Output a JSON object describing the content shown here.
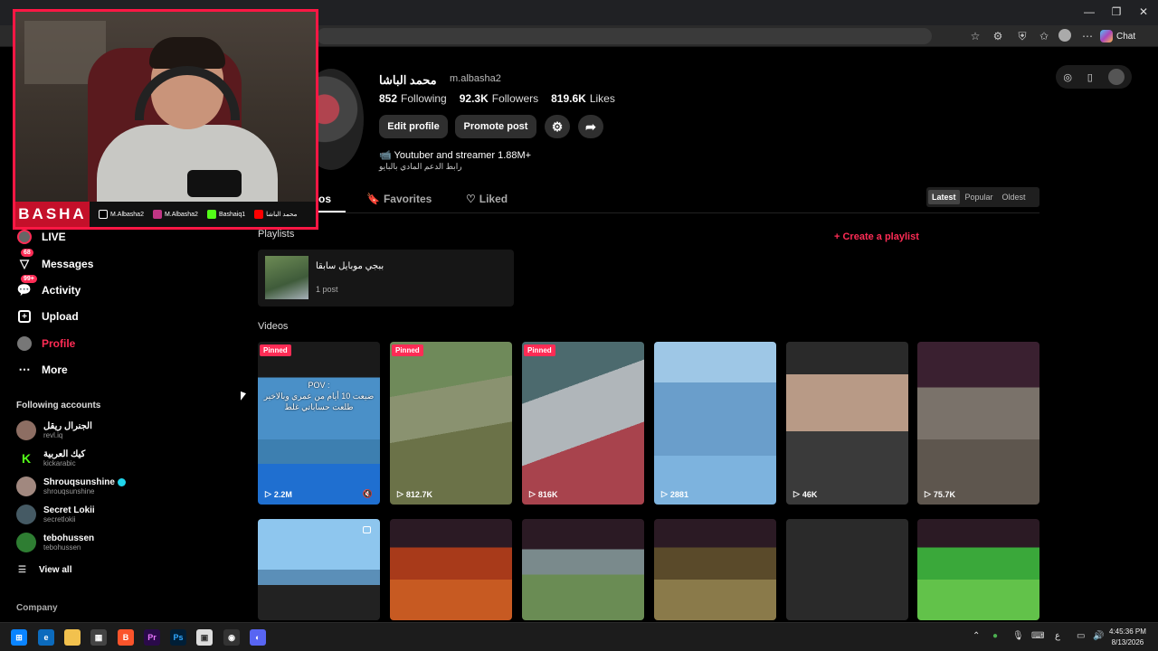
{
  "browser": {
    "chat_label": "Chat",
    "window_controls": [
      "—",
      "❐",
      "✕"
    ]
  },
  "webcam": {
    "brand": "BASHA",
    "socials": [
      {
        "label": "M.Albasha2",
        "color": "#000000",
        "icon": "tiktok-icon"
      },
      {
        "label": "M.Albasha2",
        "color": "#c13584",
        "icon": "instagram-icon"
      },
      {
        "label": "Bashaiq1",
        "color": "#53fc18",
        "icon": "kick-icon"
      },
      {
        "label": "محمد الباشا",
        "color": "#ff0000",
        "icon": "youtube-icon"
      }
    ]
  },
  "sidebar": {
    "items": [
      {
        "label": "LIVE",
        "icon": "live-icon"
      },
      {
        "label": "Messages",
        "icon": "messages-icon",
        "badge": "68"
      },
      {
        "label": "Activity",
        "icon": "activity-icon",
        "badge": "99+"
      },
      {
        "label": "Upload",
        "icon": "upload-icon"
      },
      {
        "label": "Profile",
        "icon": "profile-icon"
      },
      {
        "label": "More",
        "icon": "more-icon"
      }
    ],
    "following_title": "Following accounts",
    "accounts": [
      {
        "name": "الجنرال ريقل",
        "handle": "revl.iq",
        "color": "#8d6e63"
      },
      {
        "name": "كيك العربية",
        "handle": "kickarabic",
        "color": "#53fc18"
      },
      {
        "name": "Shrouqsunshine",
        "handle": "shrouqsunshine",
        "color": "#a1887f",
        "verified": true
      },
      {
        "name": "Secret Lokii",
        "handle": "secretlokii",
        "color": "#455a64"
      },
      {
        "name": "tebohussen",
        "handle": "tebohussen",
        "color": "#2e7d32"
      }
    ],
    "view_all": "View all",
    "company": "Company"
  },
  "profile": {
    "name": "محمد الباشا",
    "handle": "m.albasha2",
    "following_count": "852",
    "following_label": "Following",
    "followers_count": "92.3K",
    "followers_label": "Followers",
    "likes_count": "819.6K",
    "likes_label": "Likes",
    "edit_profile": "Edit profile",
    "promote_post": "Promote post",
    "bio_line1": "📹 Youtuber and streamer 1.88M+",
    "bio_line2": "رابط الدعم المادي بالبايو"
  },
  "tabs": {
    "videos_partial": "os",
    "favorites": "Favorites",
    "liked": "Liked"
  },
  "sort": {
    "options": [
      "Latest",
      "Popular",
      "Oldest"
    ],
    "selected": "Latest"
  },
  "playlists": {
    "title": "Playlists",
    "create": "+ Create a playlist",
    "items": [
      {
        "title": "ببجي موبايل سابقا",
        "count": "1 post"
      }
    ]
  },
  "videos": {
    "title": "Videos",
    "pinned_label": "Pinned",
    "row1": [
      {
        "views": "2.2M",
        "pinned": true,
        "overlay": "POV :\nضيعت 10 أيام من عمري وبالاخير\nطلعت حساباتي غلط",
        "bg": "linear-gradient(180deg,#1a1a1a 0 22%,#4a90c8 22% 60%,#3d7fb0 60% 75%,#1f6fd0 75%)"
      },
      {
        "views": "812.7K",
        "pinned": true,
        "overlay": "",
        "bg": "linear-gradient(170deg,#6f8a5a 0 30%,#8a9270 30% 55%,#6b7248 55% 100%)"
      },
      {
        "views": "816K",
        "pinned": true,
        "overlay": "",
        "bg": "linear-gradient(160deg,#4c6a6e 0 30%,#b0b6ba 30% 60%,#a8434d 60% 100%)"
      },
      {
        "views": "2881",
        "pinned": false,
        "overlay": "",
        "bg": "linear-gradient(180deg,#9ec7e6 0 25%,#6a9ecb 25% 70%,#7db3de 70%)"
      },
      {
        "views": "46K",
        "pinned": false,
        "overlay": "",
        "bg": "linear-gradient(180deg,#2a2a2a 0 20%,#b89a86 20% 55%,#3a3a3a 55%)"
      },
      {
        "views": "75.7K",
        "pinned": false,
        "overlay": "",
        "bg": "linear-gradient(180deg,#3a2030 0 28%,#7a726a 28% 60%,#5e564e 60%)"
      }
    ],
    "row2": [
      {
        "bg": "linear-gradient(180deg,#8ec6ee 0 50%,#5b8fb8 50% 65%,#222 65%)",
        "corner": true
      },
      {
        "bg": "linear-gradient(180deg,#2b1a24 0 28%,#a83a1a 28% 60%,#c75a22 60%)"
      },
      {
        "bg": "linear-gradient(180deg,#2b1a24 0 30%,#7a8a8c 30% 55%,#6a8c54 55%)"
      },
      {
        "bg": "linear-gradient(180deg,#2b1a24 0 28%,#5a4a2a 28% 60%,#8a7a4a 60%)"
      },
      {
        "bg": "#2a2a2a"
      },
      {
        "bg": "linear-gradient(180deg,#2b1a24 0 28%,#3aa83a 28% 60%,#62c24a 60%)"
      }
    ]
  },
  "taskbar": {
    "time": "4:45:36 PM",
    "date": "8/13/2026",
    "lang": "ع"
  }
}
